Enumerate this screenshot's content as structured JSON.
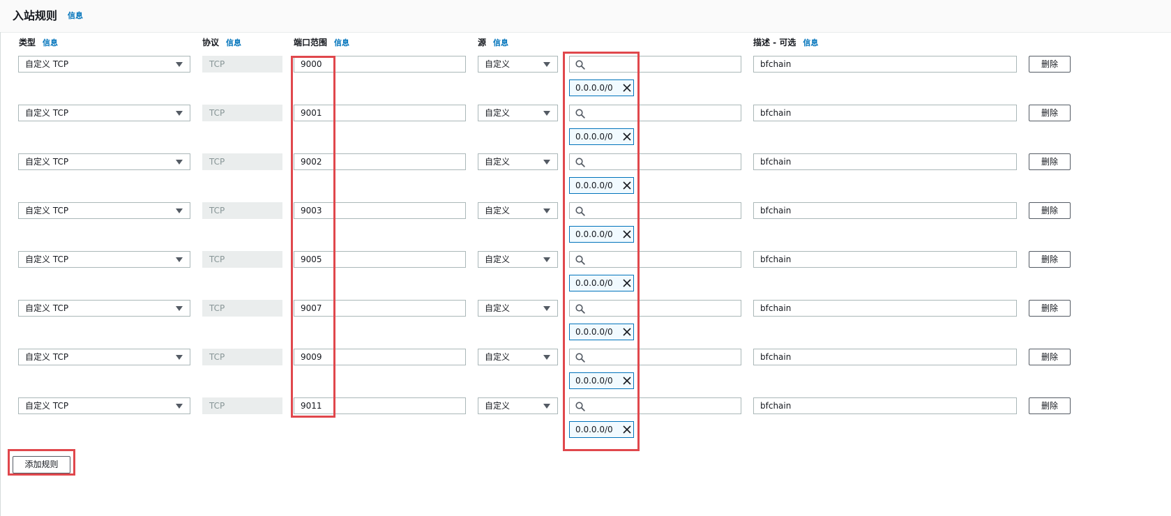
{
  "section": {
    "title": "入站规则",
    "info": "信息"
  },
  "headers": {
    "type": "类型",
    "protocol": "协议",
    "port_range": "端口范围",
    "source": "源",
    "description": "描述 - 可选",
    "info": "信息"
  },
  "rules": [
    {
      "type": "自定义 TCP",
      "protocol": "TCP",
      "port": "9000",
      "source_type": "自定义",
      "cidr": "0.0.0.0/0",
      "description": "bfchain",
      "delete_label": "删除"
    },
    {
      "type": "自定义 TCP",
      "protocol": "TCP",
      "port": "9001",
      "source_type": "自定义",
      "cidr": "0.0.0.0/0",
      "description": "bfchain",
      "delete_label": "删除"
    },
    {
      "type": "自定义 TCP",
      "protocol": "TCP",
      "port": "9002",
      "source_type": "自定义",
      "cidr": "0.0.0.0/0",
      "description": "bfchain",
      "delete_label": "删除"
    },
    {
      "type": "自定义 TCP",
      "protocol": "TCP",
      "port": "9003",
      "source_type": "自定义",
      "cidr": "0.0.0.0/0",
      "description": "bfchain",
      "delete_label": "删除"
    },
    {
      "type": "自定义 TCP",
      "protocol": "TCP",
      "port": "9005",
      "source_type": "自定义",
      "cidr": "0.0.0.0/0",
      "description": "bfchain",
      "delete_label": "删除"
    },
    {
      "type": "自定义 TCP",
      "protocol": "TCP",
      "port": "9007",
      "source_type": "自定义",
      "cidr": "0.0.0.0/0",
      "description": "bfchain",
      "delete_label": "删除"
    },
    {
      "type": "自定义 TCP",
      "protocol": "TCP",
      "port": "9009",
      "source_type": "自定义",
      "cidr": "0.0.0.0/0",
      "description": "bfchain",
      "delete_label": "删除"
    },
    {
      "type": "自定义 TCP",
      "protocol": "TCP",
      "port": "9011",
      "source_type": "自定义",
      "cidr": "0.0.0.0/0",
      "description": "bfchain",
      "delete_label": "删除"
    }
  ],
  "add_rule_label": "添加规则",
  "icons": {
    "search": "search-icon",
    "close": "close-icon",
    "dropdown": "caret-down-icon"
  },
  "colors": {
    "highlight": "#e0474c",
    "link": "#0073bb",
    "token_border": "#0073bb"
  }
}
